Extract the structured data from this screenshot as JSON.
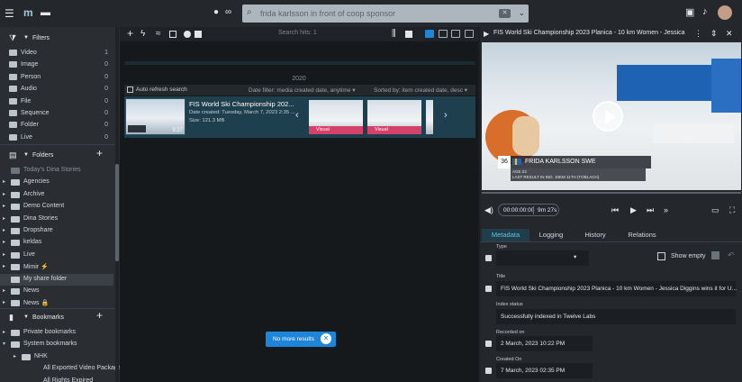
{
  "topbar": {
    "search_query": "frida karlsson in front of coop sponsor",
    "clear_label": "✕",
    "dropdown_label": "⌄"
  },
  "sidebar": {
    "filters_label": "Filters",
    "filters": [
      {
        "label": "Video",
        "count": "1"
      },
      {
        "label": "Image",
        "count": "0"
      },
      {
        "label": "Person",
        "count": "0"
      },
      {
        "label": "Audio",
        "count": "0"
      },
      {
        "label": "File",
        "count": "0"
      },
      {
        "label": "Sequence",
        "count": "0"
      },
      {
        "label": "Folder",
        "count": "0"
      },
      {
        "label": "Live",
        "count": "0"
      }
    ],
    "folders_label": "Folders",
    "folders": [
      {
        "label": "Today's Dina Stories",
        "caret": ""
      },
      {
        "label": "Agencies",
        "caret": "▸"
      },
      {
        "label": "Archive",
        "caret": "▸"
      },
      {
        "label": "Demo Content",
        "caret": "▸"
      },
      {
        "label": "Dina Stories",
        "caret": "▸"
      },
      {
        "label": "Dropshare",
        "caret": "▸"
      },
      {
        "label": "keldas",
        "caret": "▸"
      },
      {
        "label": "Live",
        "caret": "▸"
      },
      {
        "label": "Mimir ⚡",
        "caret": "▸"
      },
      {
        "label": "My share folder",
        "caret": ""
      },
      {
        "label": "News",
        "caret": "▸"
      },
      {
        "label": "News 🔒",
        "caret": "▸"
      }
    ],
    "bookmarks_label": "Bookmarks",
    "bookmarks": [
      {
        "label": "Private bookmarks",
        "caret": "▸"
      },
      {
        "label": "System bookmarks",
        "caret": "▾"
      },
      {
        "label": "NHK",
        "caret": "▸"
      },
      {
        "label": "All Exported Video Packages",
        "caret": ""
      },
      {
        "label": "All Rights Expired",
        "caret": ""
      }
    ]
  },
  "center": {
    "search_hits": "Search hits: 1",
    "year": "2020",
    "auto_refresh": "Auto refresh search",
    "date_filter": "Date filter: media created date, anytime",
    "sorted_by": "Sorted by: item created date, desc",
    "result": {
      "title": "FIS World Ski Championship 202...",
      "date": "Date created: Tuesday, March 7, 2023 2:35 ...",
      "size": "Size: 121.3 MB",
      "duration": "9:27"
    },
    "mini_label_1": "Visual",
    "mini_label_2": "Visual",
    "no_more": "No more results"
  },
  "right": {
    "title": "FIS World Ski Championship 2023 Planica - 10 km Women - Jessica",
    "lower_third": {
      "number": "36",
      "name": "FRIDA KARLSSON  SWE",
      "age": "AGE 23",
      "last_result": "LAST RESULT IN IND. 10KM   11TH (TOBLACH)"
    },
    "timecode_in": "00:00:00:00",
    "timecode_dur": "9m 27s",
    "tabs": [
      "Metadata",
      "Logging",
      "History",
      "Relations"
    ],
    "type_label": "Type",
    "show_empty": "Show empty",
    "fields": {
      "title_label": "Title",
      "title_value": "FIS World Ski Championship 2023 Planica - 10 km Women - Jessica Diggins wins it for U...",
      "index_label": "Index status",
      "index_value": "Successfully indexed in Twelve Labs",
      "recorded_label": "Recorded on",
      "recorded_value": "2 March, 2023 10:22 PM",
      "created_label": "Created On",
      "created_value": "7 March, 2023 02:35 PM"
    }
  },
  "colors": {
    "accent": "#5cc4e8",
    "card_bg": "#1d3f4e",
    "toast": "#1e86d8",
    "visual_tag": "#d6416a"
  }
}
